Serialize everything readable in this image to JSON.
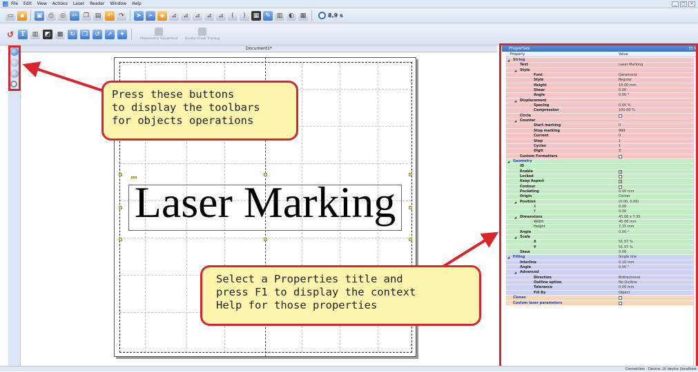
{
  "menu": {
    "items": [
      "File",
      "Edit",
      "View",
      "Actions",
      "Laser",
      "Reader",
      "Window",
      "Help"
    ]
  },
  "window_controls": [
    "_",
    "▢",
    "×"
  ],
  "toolbar": {
    "timer_label": "8,9 s",
    "photometric_label": "Photometric Adjustment",
    "quality_label": "Quality Grade Training"
  },
  "document": {
    "tab_title": "Document1*",
    "marking_text": "Laser Marking"
  },
  "callouts": {
    "left": [
      "Press these buttons",
      "to display the toolbars",
      "for objects operations"
    ],
    "right": [
      "Select a Properties title and",
      "press F1 to display the context",
      "Help for those properties"
    ]
  },
  "properties": {
    "title": "Properties",
    "header_property": "Property",
    "header_value": "Value",
    "rows": [
      {
        "name": "String",
        "value": "",
        "color": "pink",
        "indent": 0,
        "kind": "cat",
        "expander": "◢"
      },
      {
        "name": "Text",
        "value": "Laser Marking",
        "color": "pink",
        "indent": 1,
        "kind": "bold"
      },
      {
        "name": "Style",
        "value": "",
        "color": "pink",
        "indent": 1,
        "kind": "bold",
        "expander": "◢"
      },
      {
        "name": "Font",
        "value": "Garamond",
        "color": "pink",
        "indent": 2,
        "kind": "bold"
      },
      {
        "name": "Style",
        "value": "Regular",
        "color": "pink",
        "indent": 2,
        "kind": "bold"
      },
      {
        "name": "Height",
        "value": "10.00 mm",
        "color": "pink",
        "indent": 2,
        "kind": "bold"
      },
      {
        "name": "Shear",
        "value": "0.00",
        "color": "pink",
        "indent": 2,
        "kind": "bold"
      },
      {
        "name": "Angle",
        "value": "0.00 °",
        "color": "pink",
        "indent": 2,
        "kind": "bold"
      },
      {
        "name": "Displacement",
        "value": "",
        "color": "pink",
        "indent": 1,
        "kind": "bold",
        "expander": "◢"
      },
      {
        "name": "Spacing",
        "value": "0.00 %",
        "color": "pink",
        "indent": 2,
        "kind": "bold"
      },
      {
        "name": "Compression",
        "value": "100.00 %",
        "color": "pink",
        "indent": 2,
        "kind": "bold"
      },
      {
        "name": "Circle",
        "value": "",
        "color": "pink",
        "indent": 1,
        "kind": "bold",
        "checkbox": "unchecked"
      },
      {
        "name": "Counter",
        "value": "",
        "color": "pink",
        "indent": 1,
        "kind": "bold",
        "expander": "◢"
      },
      {
        "name": "Start marking",
        "value": "0",
        "color": "pink",
        "indent": 2,
        "kind": "bold"
      },
      {
        "name": "Stop marking",
        "value": "999",
        "color": "pink",
        "indent": 2,
        "kind": "bold"
      },
      {
        "name": "Current",
        "value": "0",
        "color": "pink",
        "indent": 2,
        "kind": "bold"
      },
      {
        "name": "Step",
        "value": "1",
        "color": "pink",
        "indent": 2,
        "kind": "bold"
      },
      {
        "name": "Cycles",
        "value": "1",
        "color": "pink",
        "indent": 2,
        "kind": "bold"
      },
      {
        "name": "Digit",
        "value": "3",
        "color": "pink",
        "indent": 2,
        "kind": "bold"
      },
      {
        "name": "Custom Formatters",
        "value": "",
        "color": "pink",
        "indent": 1,
        "kind": "bold",
        "checkbox": "unchecked"
      },
      {
        "name": "Geometry",
        "value": "",
        "color": "green",
        "indent": 0,
        "kind": "cat",
        "expander": "◢"
      },
      {
        "name": "ID",
        "value": "",
        "color": "green",
        "indent": 1,
        "kind": "bold"
      },
      {
        "name": "Enable",
        "value": "",
        "color": "green",
        "indent": 1,
        "kind": "bold",
        "checkbox": "checked"
      },
      {
        "name": "Locked",
        "value": "",
        "color": "green",
        "indent": 1,
        "kind": "bold",
        "checkbox": "unchecked"
      },
      {
        "name": "Keep Aspect",
        "value": "",
        "color": "green",
        "indent": 1,
        "kind": "bold",
        "checkbox": "checked"
      },
      {
        "name": "Contour",
        "value": "",
        "color": "green",
        "indent": 1,
        "kind": "bold",
        "checkbox": "unchecked"
      },
      {
        "name": "Pocketing",
        "value": "0.00 mm",
        "color": "green",
        "indent": 1,
        "kind": "bold"
      },
      {
        "name": "Origin",
        "value": "Center",
        "color": "green",
        "indent": 1,
        "kind": "bold"
      },
      {
        "name": "Position",
        "value": "(0.00, 0.00)",
        "color": "green",
        "indent": 1,
        "kind": "bold",
        "expander": "◢"
      },
      {
        "name": "X",
        "value": "0.00",
        "color": "green",
        "indent": 2,
        "kind": "normal"
      },
      {
        "name": "Y",
        "value": "0.00",
        "color": "green",
        "indent": 2,
        "kind": "normal"
      },
      {
        "name": "Dimensions",
        "value": "45.06 x 7.35",
        "color": "green",
        "indent": 1,
        "kind": "bold",
        "expander": "◢"
      },
      {
        "name": "Width",
        "value": "45.06 mm",
        "color": "green",
        "indent": 2,
        "kind": "normal"
      },
      {
        "name": "Height",
        "value": "7.35 mm",
        "color": "green",
        "indent": 2,
        "kind": "normal"
      },
      {
        "name": "Angle",
        "value": "0.00 °",
        "color": "green",
        "indent": 1,
        "kind": "bold"
      },
      {
        "name": "Scale",
        "value": "",
        "color": "green",
        "indent": 1,
        "kind": "bold",
        "expander": "◢"
      },
      {
        "name": "X",
        "value": "51.57 %",
        "color": "green",
        "indent": 2,
        "kind": "bold"
      },
      {
        "name": "Y",
        "value": "51.57 %",
        "color": "green",
        "indent": 2,
        "kind": "bold"
      },
      {
        "name": "Skew",
        "value": "0.00",
        "color": "green",
        "indent": 1,
        "kind": "bold"
      },
      {
        "name": "Filling",
        "value": "Single line",
        "color": "blue",
        "indent": 0,
        "kind": "cat",
        "expander": "◢"
      },
      {
        "name": "Interline",
        "value": "0.10 mm",
        "color": "blue",
        "indent": 1,
        "kind": "bold"
      },
      {
        "name": "Angle",
        "value": "0.00 °",
        "color": "blue",
        "indent": 1,
        "kind": "bold"
      },
      {
        "name": "Advanced",
        "value": "",
        "color": "blue",
        "indent": 1,
        "kind": "bold",
        "expander": "◢"
      },
      {
        "name": "Direction",
        "value": "Bidirectional",
        "color": "blue",
        "indent": 2,
        "kind": "bold"
      },
      {
        "name": "Outline option",
        "value": "No Outline",
        "color": "blue",
        "indent": 2,
        "kind": "bold"
      },
      {
        "name": "Tolerance",
        "value": "0.00 mm",
        "color": "blue",
        "indent": 2,
        "kind": "bold"
      },
      {
        "name": "Fill By",
        "value": "Object",
        "color": "blue",
        "indent": 2,
        "kind": "bold"
      },
      {
        "name": "Clones",
        "value": "",
        "color": "orange",
        "indent": 0,
        "kind": "cat",
        "checkbox": "unchecked"
      },
      {
        "name": "Custom laser parameters",
        "value": "",
        "color": "orange",
        "indent": 0,
        "kind": "cat",
        "checkbox": "unchecked"
      }
    ]
  },
  "status": {
    "text": "Connection : Device: LV device (localhost"
  },
  "colors": {
    "accent_red": "#d8262c",
    "callout_fill": "#fdf4ae"
  }
}
